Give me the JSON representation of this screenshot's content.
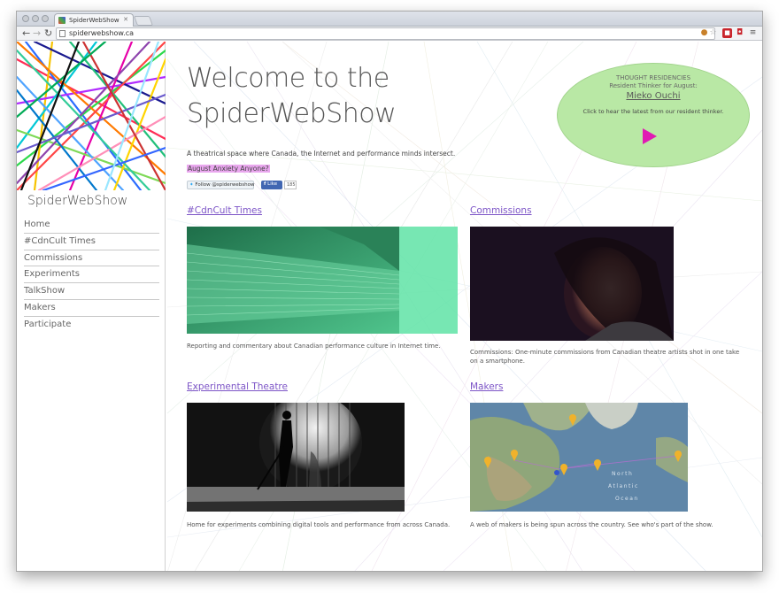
{
  "browser": {
    "tab_title": "SpiderWebShow",
    "url": "spiderwebshow.ca"
  },
  "sidebar": {
    "site_name": "SpiderWebShow",
    "nav": [
      {
        "label": "Home"
      },
      {
        "label": "#CdnCult Times"
      },
      {
        "label": "Commissions"
      },
      {
        "label": "Experiments"
      },
      {
        "label": "TalkShow"
      },
      {
        "label": "Makers"
      },
      {
        "label": "Participate"
      }
    ]
  },
  "main": {
    "welcome": "Welcome to the SpiderWebShow",
    "tagline": "A theatrical space where Canada, the Internet and performance minds intersect.",
    "highlight_link": "August Anxiety Anyone?",
    "twitter_button": "Follow @spiderwebshow",
    "facebook_button": "Like",
    "facebook_count": "185",
    "sections": [
      {
        "title": "#CdnCult Times",
        "caption": "Reporting and commentary about Canadian performance culture in Internet time."
      },
      {
        "title": "Commissions",
        "caption": "Commissions: One-minute commissions from Canadian theatre artists shot in one take on a smartphone."
      },
      {
        "title": "Experimental Theatre",
        "caption": "Home for experiments combining digital tools and performance from across Canada."
      },
      {
        "title": "Makers",
        "caption": "A web of makers is being spun across the country. See who's part of the show."
      }
    ],
    "map_labels": {
      "north": "North",
      "atlantic": "Atlantic",
      "ocean": "Ocean"
    }
  },
  "residency": {
    "line1": "THOUGHT RESIDENCIES",
    "line2": "Resident Thinker for August:",
    "name": "Mieko Ouchi",
    "cta": "Click to hear the latest from our resident thinker."
  },
  "colors": {
    "link": "#7d55c7",
    "highlight": "#e9a7ee",
    "bubble": "#b9e8a5",
    "play": "#e01ab3",
    "cdncult_overlay": "#5fe3a6"
  }
}
